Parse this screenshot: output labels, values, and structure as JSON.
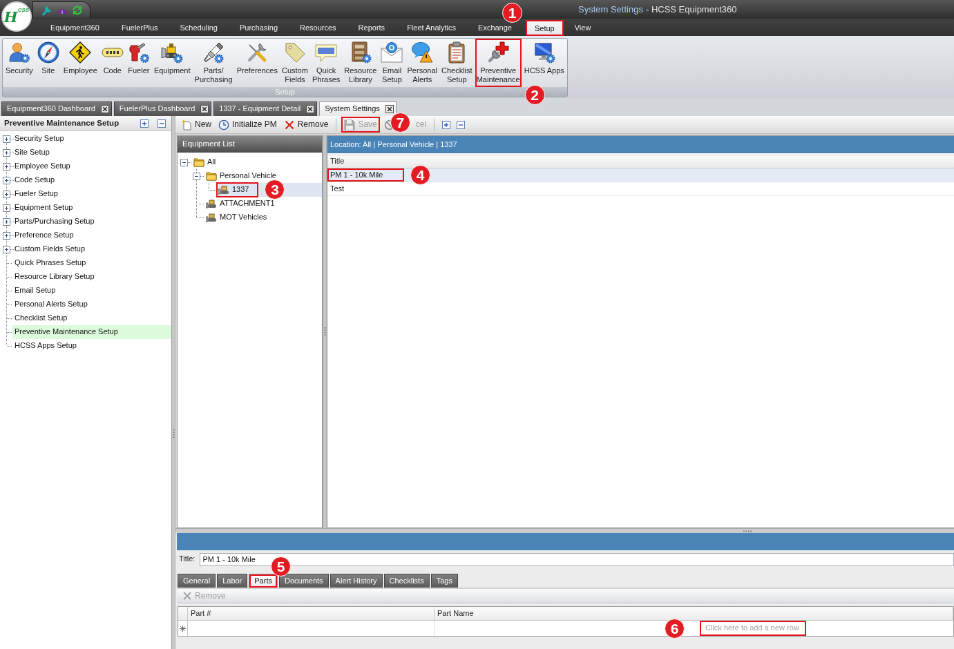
{
  "window": {
    "document_title": "System Settings",
    "app_title": "- HCSS Equipment360"
  },
  "logo": {
    "text": "H$^{CSS}$"
  },
  "menu_tabs": [
    {
      "label": "Equipment360",
      "selected": false
    },
    {
      "label": "FuelerPlus",
      "selected": false
    },
    {
      "label": "Scheduling",
      "selected": false
    },
    {
      "label": "Purchasing",
      "selected": false
    },
    {
      "label": "Resources",
      "selected": false
    },
    {
      "label": "Reports",
      "selected": false
    },
    {
      "label": "Fleet Analytics",
      "selected": false
    },
    {
      "label": "Exchange",
      "selected": false
    },
    {
      "label": "Setup",
      "selected": true,
      "annotation": "1"
    },
    {
      "label": "View",
      "selected": false
    }
  ],
  "ribbon": {
    "group_label": "Setup",
    "buttons": [
      {
        "label": "Security"
      },
      {
        "label": "Site"
      },
      {
        "label": "Employee"
      },
      {
        "label": "Code"
      },
      {
        "label": "Fueler"
      },
      {
        "label": "Equipment"
      },
      {
        "label": "Parts/\nPurchasing"
      },
      {
        "label": "Preferences"
      },
      {
        "label": "Custom\nFields"
      },
      {
        "label": "Quick\nPhrases"
      },
      {
        "label": "Resource\nLibrary"
      },
      {
        "label": "Email\nSetup"
      },
      {
        "label": "Personal\nAlerts"
      },
      {
        "label": "Checklist\nSetup"
      },
      {
        "label": "Preventive\nMaintenance",
        "annotation": "2"
      },
      {
        "label": "HCSS Apps"
      }
    ]
  },
  "document_tabs": [
    {
      "label": "Equipment360 Dashboard",
      "selected": false
    },
    {
      "label": "FuelerPlus Dashboard",
      "selected": false
    },
    {
      "label": "1337 - Equipment Detail",
      "selected": false
    },
    {
      "label": "System Settings",
      "selected": true
    }
  ],
  "setup_tree": {
    "title": "Preventive Maintenance Setup",
    "items": [
      {
        "label": "Security Setup",
        "expandable": true,
        "selected": false
      },
      {
        "label": "Site Setup",
        "expandable": true,
        "selected": false
      },
      {
        "label": "Employee Setup",
        "expandable": true,
        "selected": false
      },
      {
        "label": "Code Setup",
        "expandable": true,
        "selected": false
      },
      {
        "label": "Fueler Setup",
        "expandable": true,
        "selected": false
      },
      {
        "label": "Equipment Setup",
        "expandable": true,
        "selected": false
      },
      {
        "label": "Parts/Purchasing Setup",
        "expandable": true,
        "selected": false
      },
      {
        "label": "Preference Setup",
        "expandable": true,
        "selected": false
      },
      {
        "label": "Custom Fields Setup",
        "expandable": true,
        "selected": false
      },
      {
        "label": "Quick Phrases Setup",
        "expandable": false,
        "selected": false
      },
      {
        "label": "Resource Library Setup",
        "expandable": false,
        "selected": false
      },
      {
        "label": "Email Setup",
        "expandable": false,
        "selected": false
      },
      {
        "label": "Personal Alerts Setup",
        "expandable": false,
        "selected": false
      },
      {
        "label": "Checklist Setup",
        "expandable": false,
        "selected": false
      },
      {
        "label": "Preventive Maintenance Setup",
        "expandable": false,
        "selected": true
      },
      {
        "label": "HCSS Apps Setup",
        "expandable": false,
        "selected": false
      }
    ]
  },
  "toolbar": [
    {
      "label": "New",
      "disabled": false
    },
    {
      "label": "Initialize PM",
      "disabled": false
    },
    {
      "label": "Remove",
      "disabled": false
    },
    {
      "label": "Save",
      "disabled": true,
      "annotation": "7"
    },
    {
      "label": "cel",
      "disabled": true
    }
  ],
  "equipment_list": {
    "title": "Equipment List",
    "tree": [
      {
        "label": "All",
        "kind": "folder",
        "expanded": true,
        "selected": false,
        "children": [
          {
            "label": "Personal Vehicle",
            "kind": "folder",
            "expanded": true,
            "selected": false,
            "children": [
              {
                "label": "1337",
                "kind": "equipment",
                "selected": true,
                "annotation": "3"
              }
            ]
          },
          {
            "label": "ATTACHMENT1",
            "kind": "equipment",
            "selected": false
          },
          {
            "label": "MOT Vehicles",
            "kind": "equipment",
            "selected": false
          }
        ]
      }
    ]
  },
  "pm_grid": {
    "location": "Location: All | Personal Vehicle | 1337",
    "columns": [
      "Title"
    ],
    "rows": [
      {
        "title": "PM 1 - 10k Mile",
        "selected": true,
        "annotation": "4"
      },
      {
        "title": "Test",
        "selected": false
      }
    ]
  },
  "detail": {
    "title_label": "Title:",
    "title_value": "PM 1 - 10k Mile",
    "tabs": [
      {
        "label": "General",
        "selected": false
      },
      {
        "label": "Labor",
        "selected": false
      },
      {
        "label": "Parts",
        "selected": true,
        "annotation": "5"
      },
      {
        "label": "Documents",
        "selected": false
      },
      {
        "label": "Alert History",
        "selected": false
      },
      {
        "label": "Checklists",
        "selected": false
      },
      {
        "label": "Tags",
        "selected": false
      }
    ],
    "toolbar": [
      {
        "label": "Remove",
        "disabled": true
      }
    ],
    "parts_grid": {
      "columns": [
        "Part #",
        "Part Name"
      ],
      "new_row": {
        "placeholder": "Click here to add a new row",
        "annotation": "6"
      }
    }
  }
}
